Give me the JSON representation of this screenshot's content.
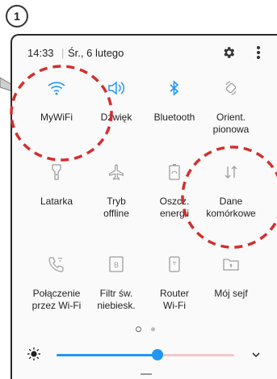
{
  "step_number": "1",
  "status": {
    "time": "14:33",
    "separator": "|",
    "date": "Śr., 6 lutego"
  },
  "header": {
    "settings_icon": "gear-icon",
    "more_icon": "more-vert-icon"
  },
  "tiles": [
    {
      "label": "MyWiFi",
      "icon": "wifi-icon",
      "active": true
    },
    {
      "label": "Dźwięk",
      "icon": "sound-icon",
      "active": true
    },
    {
      "label": "Bluetooth",
      "icon": "bluetooth-icon",
      "active": true
    },
    {
      "label": "Orient. pionowa",
      "icon": "rotation-icon",
      "active": false
    },
    {
      "label": "Latarka",
      "icon": "flashlight-icon",
      "active": false
    },
    {
      "label": "Tryb offline",
      "icon": "airplane-icon",
      "active": false
    },
    {
      "label": "Oszcz. energii",
      "icon": "battery-saver-icon",
      "active": false
    },
    {
      "label": "Dane komórkowe",
      "icon": "mobile-data-icon",
      "active": false
    },
    {
      "label": "Połączenie przez Wi-Fi",
      "icon": "wifi-calling-icon",
      "active": false
    },
    {
      "label": "Filtr św. niebiesk.",
      "icon": "blue-light-filter-icon",
      "active": false
    },
    {
      "label": "Router Wi-Fi",
      "icon": "hotspot-icon",
      "active": false
    },
    {
      "label": "Mój sejf",
      "icon": "secure-folder-icon",
      "active": false
    }
  ],
  "pager": {
    "pages": 2,
    "current": 1
  },
  "brightness": {
    "level": 0.57
  },
  "colors": {
    "active": "#2196f3",
    "inactive": "#9e9e9e",
    "highlight": "#d32f2f"
  }
}
